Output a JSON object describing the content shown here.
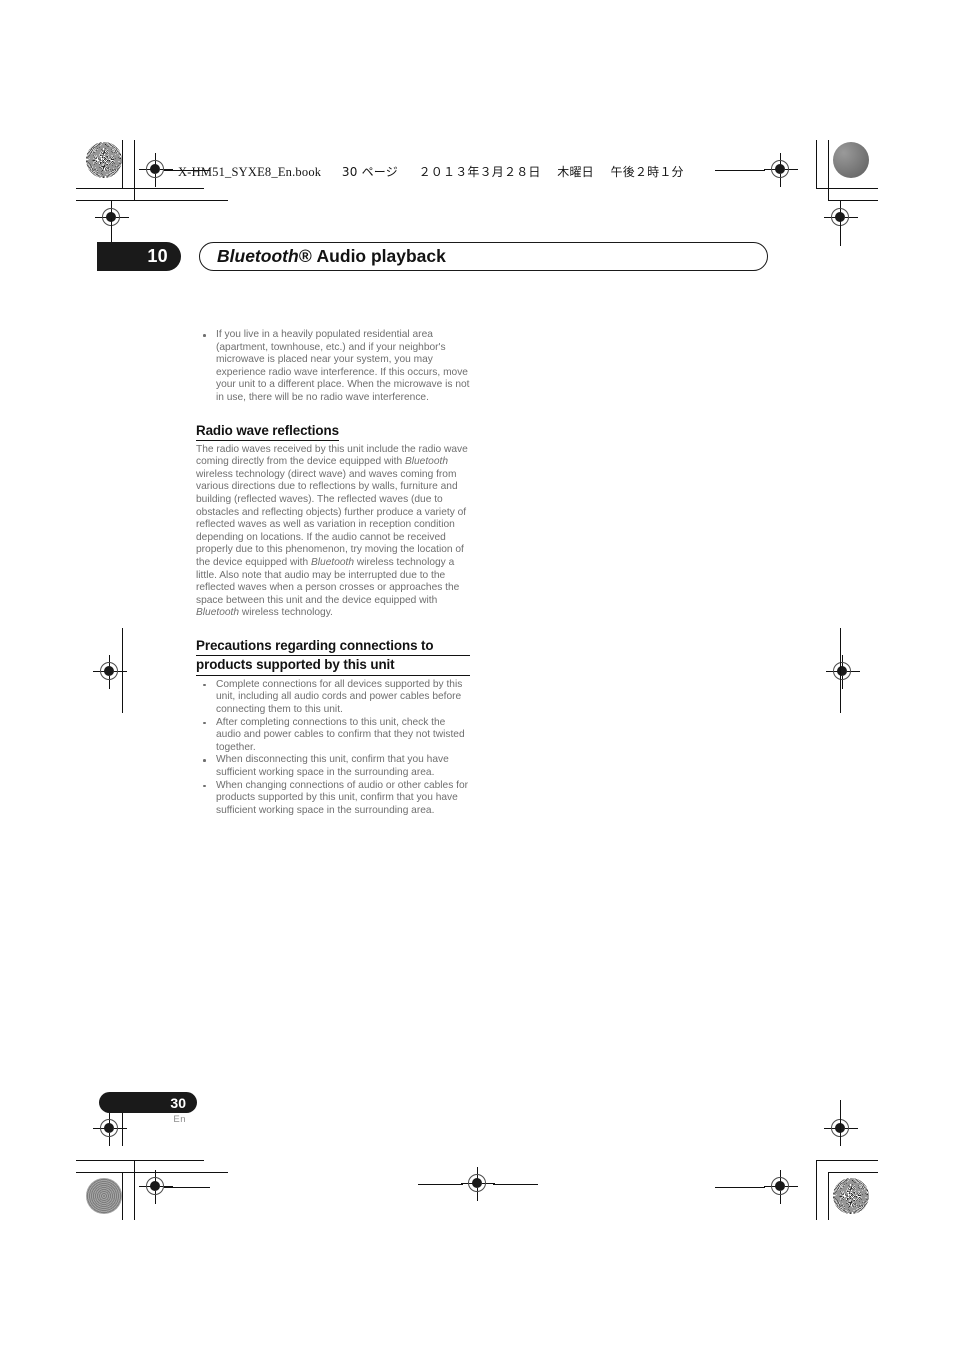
{
  "header": {
    "filename": "X-HM51_SYXE8_En.book",
    "page_marker": "30 ページ",
    "date": "２０１３年３月２８日",
    "weekday": "木曜日",
    "time": "午後２時１分"
  },
  "chapter": {
    "number": "10",
    "title_italic": "Bluetooth®",
    "title_bold": "Audio playback"
  },
  "content": {
    "intro_bullets": [
      "If you live in a heavily populated residential area (apartment, townhouse, etc.) and if your neighbor's microwave is placed near your system, you may experience radio wave interference. If this occurs, move your unit to a different place. When the microwave is not in use, there will be no radio wave interference."
    ],
    "section_reflections": {
      "heading": "Radio wave reflections",
      "paragraph_part_1": "The radio waves received by this unit include the radio wave coming directly from the device equipped with ",
      "paragraph_italic_1": "Bluetooth",
      "paragraph_part_2": " wireless technology (direct wave) and waves coming from various directions due to reflections by walls, furniture and building (reflected waves). The reflected waves (due to obstacles and reflecting objects) further produce a variety of reflected waves as well as variation in reception condition depending on locations. If the audio cannot be received properly due to this phenomenon, try moving the location of the device equipped with ",
      "paragraph_italic_2": "Bluetooth",
      "paragraph_part_3": " wireless technology a little. Also note that audio may be interrupted due to the reflected waves when a person crosses or approaches the space between this unit and the device equipped with ",
      "paragraph_italic_3": "Bluetooth",
      "paragraph_part_4": " wireless technology."
    },
    "section_precautions": {
      "heading_line_1": "Precautions regarding connections to",
      "heading_line_2": "products supported by this unit",
      "bullets": [
        "Complete connections for all devices supported by this unit, including all audio cords and power cables before connecting them to this unit.",
        "After completing connections to this unit, check the audio and power cables to confirm that they not twisted together.",
        "When disconnecting this unit, confirm that you have sufficient working space in the surrounding area.",
        "When changing connections of audio or other cables for products supported by this unit, confirm that you have sufficient working space in the surrounding area."
      ]
    }
  },
  "footer": {
    "page_number": "30",
    "language": "En"
  },
  "colors": {
    "ink_black": "#1a1a1a",
    "body_gray": "#6f6f6f",
    "mark_gray": "#8a8a8a"
  }
}
